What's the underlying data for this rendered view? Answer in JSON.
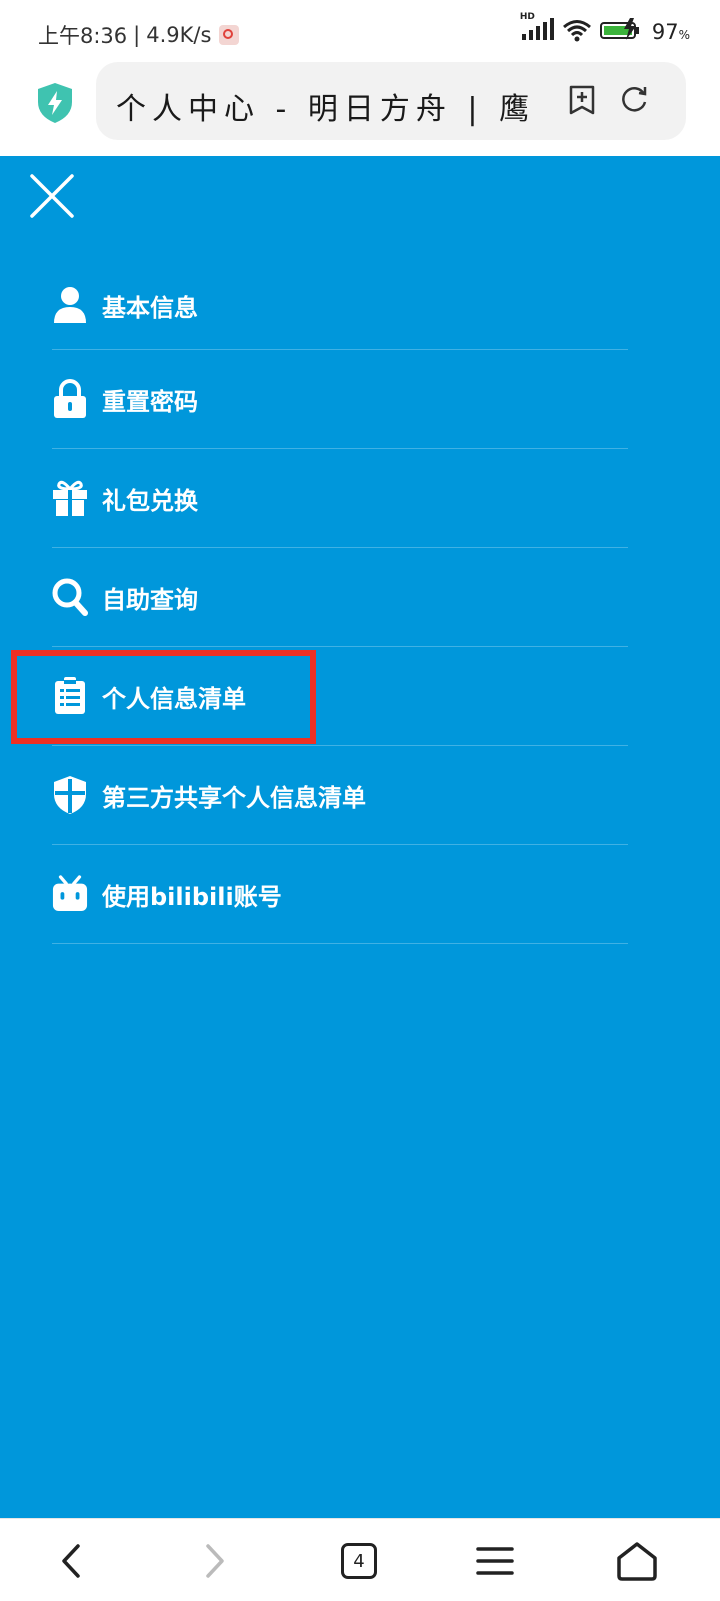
{
  "status_bar": {
    "time": "上午8:36",
    "speed": "4.9K/s",
    "signal_label": "HD",
    "battery": "97"
  },
  "address_bar": {
    "url_title": "个人中心 - 明日方舟 | 鹰角网络",
    "security_icon": "shield-lightning-icon",
    "add_tab_icon": "add-bookmark-icon",
    "refresh_icon": "refresh-icon"
  },
  "menu": {
    "close_icon": "close-icon",
    "items": [
      {
        "label": "基本信息",
        "icon": "user-icon"
      },
      {
        "label": "重置密码",
        "icon": "lock-icon"
      },
      {
        "label": "礼包兑换",
        "icon": "gift-icon"
      },
      {
        "label": "自助查询",
        "icon": "search-icon"
      },
      {
        "label": "个人信息清单",
        "icon": "clipboard-list-icon",
        "highlighted": true
      },
      {
        "label": "第三方共享个人信息清单",
        "icon": "shield-cross-icon"
      },
      {
        "label": "使用bilibili账号",
        "icon": "bilibili-icon"
      }
    ],
    "background_color": "#0097db",
    "highlight_color": "#ee3023"
  },
  "bottom_nav": {
    "back_icon": "back-icon",
    "forward_icon": "forward-icon",
    "tab_count": "4",
    "menu_icon": "hamburger-icon",
    "home_icon": "home-icon"
  }
}
